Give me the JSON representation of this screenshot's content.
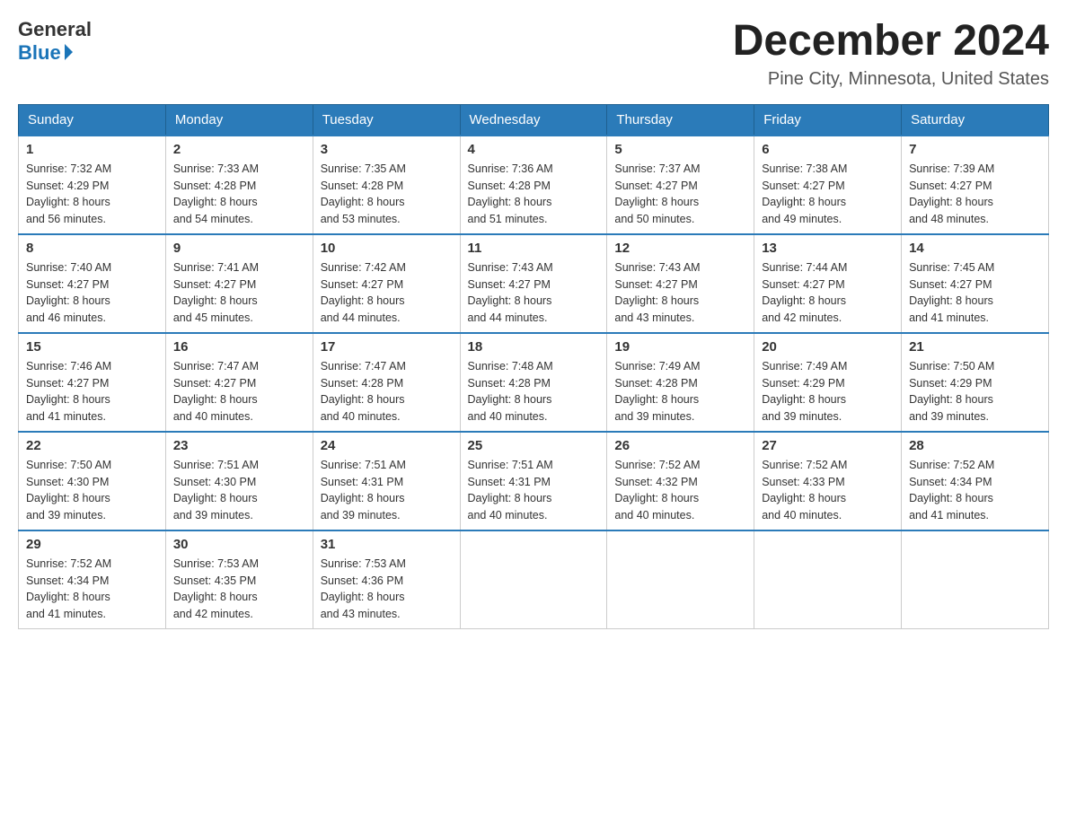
{
  "logo": {
    "general": "General",
    "blue": "Blue"
  },
  "title": "December 2024",
  "subtitle": "Pine City, Minnesota, United States",
  "weekdays": [
    "Sunday",
    "Monday",
    "Tuesday",
    "Wednesday",
    "Thursday",
    "Friday",
    "Saturday"
  ],
  "weeks": [
    [
      {
        "day": "1",
        "sunrise": "7:32 AM",
        "sunset": "4:29 PM",
        "daylight": "8 hours and 56 minutes."
      },
      {
        "day": "2",
        "sunrise": "7:33 AM",
        "sunset": "4:28 PM",
        "daylight": "8 hours and 54 minutes."
      },
      {
        "day": "3",
        "sunrise": "7:35 AM",
        "sunset": "4:28 PM",
        "daylight": "8 hours and 53 minutes."
      },
      {
        "day": "4",
        "sunrise": "7:36 AM",
        "sunset": "4:28 PM",
        "daylight": "8 hours and 51 minutes."
      },
      {
        "day": "5",
        "sunrise": "7:37 AM",
        "sunset": "4:27 PM",
        "daylight": "8 hours and 50 minutes."
      },
      {
        "day": "6",
        "sunrise": "7:38 AM",
        "sunset": "4:27 PM",
        "daylight": "8 hours and 49 minutes."
      },
      {
        "day": "7",
        "sunrise": "7:39 AM",
        "sunset": "4:27 PM",
        "daylight": "8 hours and 48 minutes."
      }
    ],
    [
      {
        "day": "8",
        "sunrise": "7:40 AM",
        "sunset": "4:27 PM",
        "daylight": "8 hours and 46 minutes."
      },
      {
        "day": "9",
        "sunrise": "7:41 AM",
        "sunset": "4:27 PM",
        "daylight": "8 hours and 45 minutes."
      },
      {
        "day": "10",
        "sunrise": "7:42 AM",
        "sunset": "4:27 PM",
        "daylight": "8 hours and 44 minutes."
      },
      {
        "day": "11",
        "sunrise": "7:43 AM",
        "sunset": "4:27 PM",
        "daylight": "8 hours and 44 minutes."
      },
      {
        "day": "12",
        "sunrise": "7:43 AM",
        "sunset": "4:27 PM",
        "daylight": "8 hours and 43 minutes."
      },
      {
        "day": "13",
        "sunrise": "7:44 AM",
        "sunset": "4:27 PM",
        "daylight": "8 hours and 42 minutes."
      },
      {
        "day": "14",
        "sunrise": "7:45 AM",
        "sunset": "4:27 PM",
        "daylight": "8 hours and 41 minutes."
      }
    ],
    [
      {
        "day": "15",
        "sunrise": "7:46 AM",
        "sunset": "4:27 PM",
        "daylight": "8 hours and 41 minutes."
      },
      {
        "day": "16",
        "sunrise": "7:47 AM",
        "sunset": "4:27 PM",
        "daylight": "8 hours and 40 minutes."
      },
      {
        "day": "17",
        "sunrise": "7:47 AM",
        "sunset": "4:28 PM",
        "daylight": "8 hours and 40 minutes."
      },
      {
        "day": "18",
        "sunrise": "7:48 AM",
        "sunset": "4:28 PM",
        "daylight": "8 hours and 40 minutes."
      },
      {
        "day": "19",
        "sunrise": "7:49 AM",
        "sunset": "4:28 PM",
        "daylight": "8 hours and 39 minutes."
      },
      {
        "day": "20",
        "sunrise": "7:49 AM",
        "sunset": "4:29 PM",
        "daylight": "8 hours and 39 minutes."
      },
      {
        "day": "21",
        "sunrise": "7:50 AM",
        "sunset": "4:29 PM",
        "daylight": "8 hours and 39 minutes."
      }
    ],
    [
      {
        "day": "22",
        "sunrise": "7:50 AM",
        "sunset": "4:30 PM",
        "daylight": "8 hours and 39 minutes."
      },
      {
        "day": "23",
        "sunrise": "7:51 AM",
        "sunset": "4:30 PM",
        "daylight": "8 hours and 39 minutes."
      },
      {
        "day": "24",
        "sunrise": "7:51 AM",
        "sunset": "4:31 PM",
        "daylight": "8 hours and 39 minutes."
      },
      {
        "day": "25",
        "sunrise": "7:51 AM",
        "sunset": "4:31 PM",
        "daylight": "8 hours and 40 minutes."
      },
      {
        "day": "26",
        "sunrise": "7:52 AM",
        "sunset": "4:32 PM",
        "daylight": "8 hours and 40 minutes."
      },
      {
        "day": "27",
        "sunrise": "7:52 AM",
        "sunset": "4:33 PM",
        "daylight": "8 hours and 40 minutes."
      },
      {
        "day": "28",
        "sunrise": "7:52 AM",
        "sunset": "4:34 PM",
        "daylight": "8 hours and 41 minutes."
      }
    ],
    [
      {
        "day": "29",
        "sunrise": "7:52 AM",
        "sunset": "4:34 PM",
        "daylight": "8 hours and 41 minutes."
      },
      {
        "day": "30",
        "sunrise": "7:53 AM",
        "sunset": "4:35 PM",
        "daylight": "8 hours and 42 minutes."
      },
      {
        "day": "31",
        "sunrise": "7:53 AM",
        "sunset": "4:36 PM",
        "daylight": "8 hours and 43 minutes."
      },
      null,
      null,
      null,
      null
    ]
  ],
  "labels": {
    "sunrise": "Sunrise:",
    "sunset": "Sunset:",
    "daylight": "Daylight:"
  }
}
